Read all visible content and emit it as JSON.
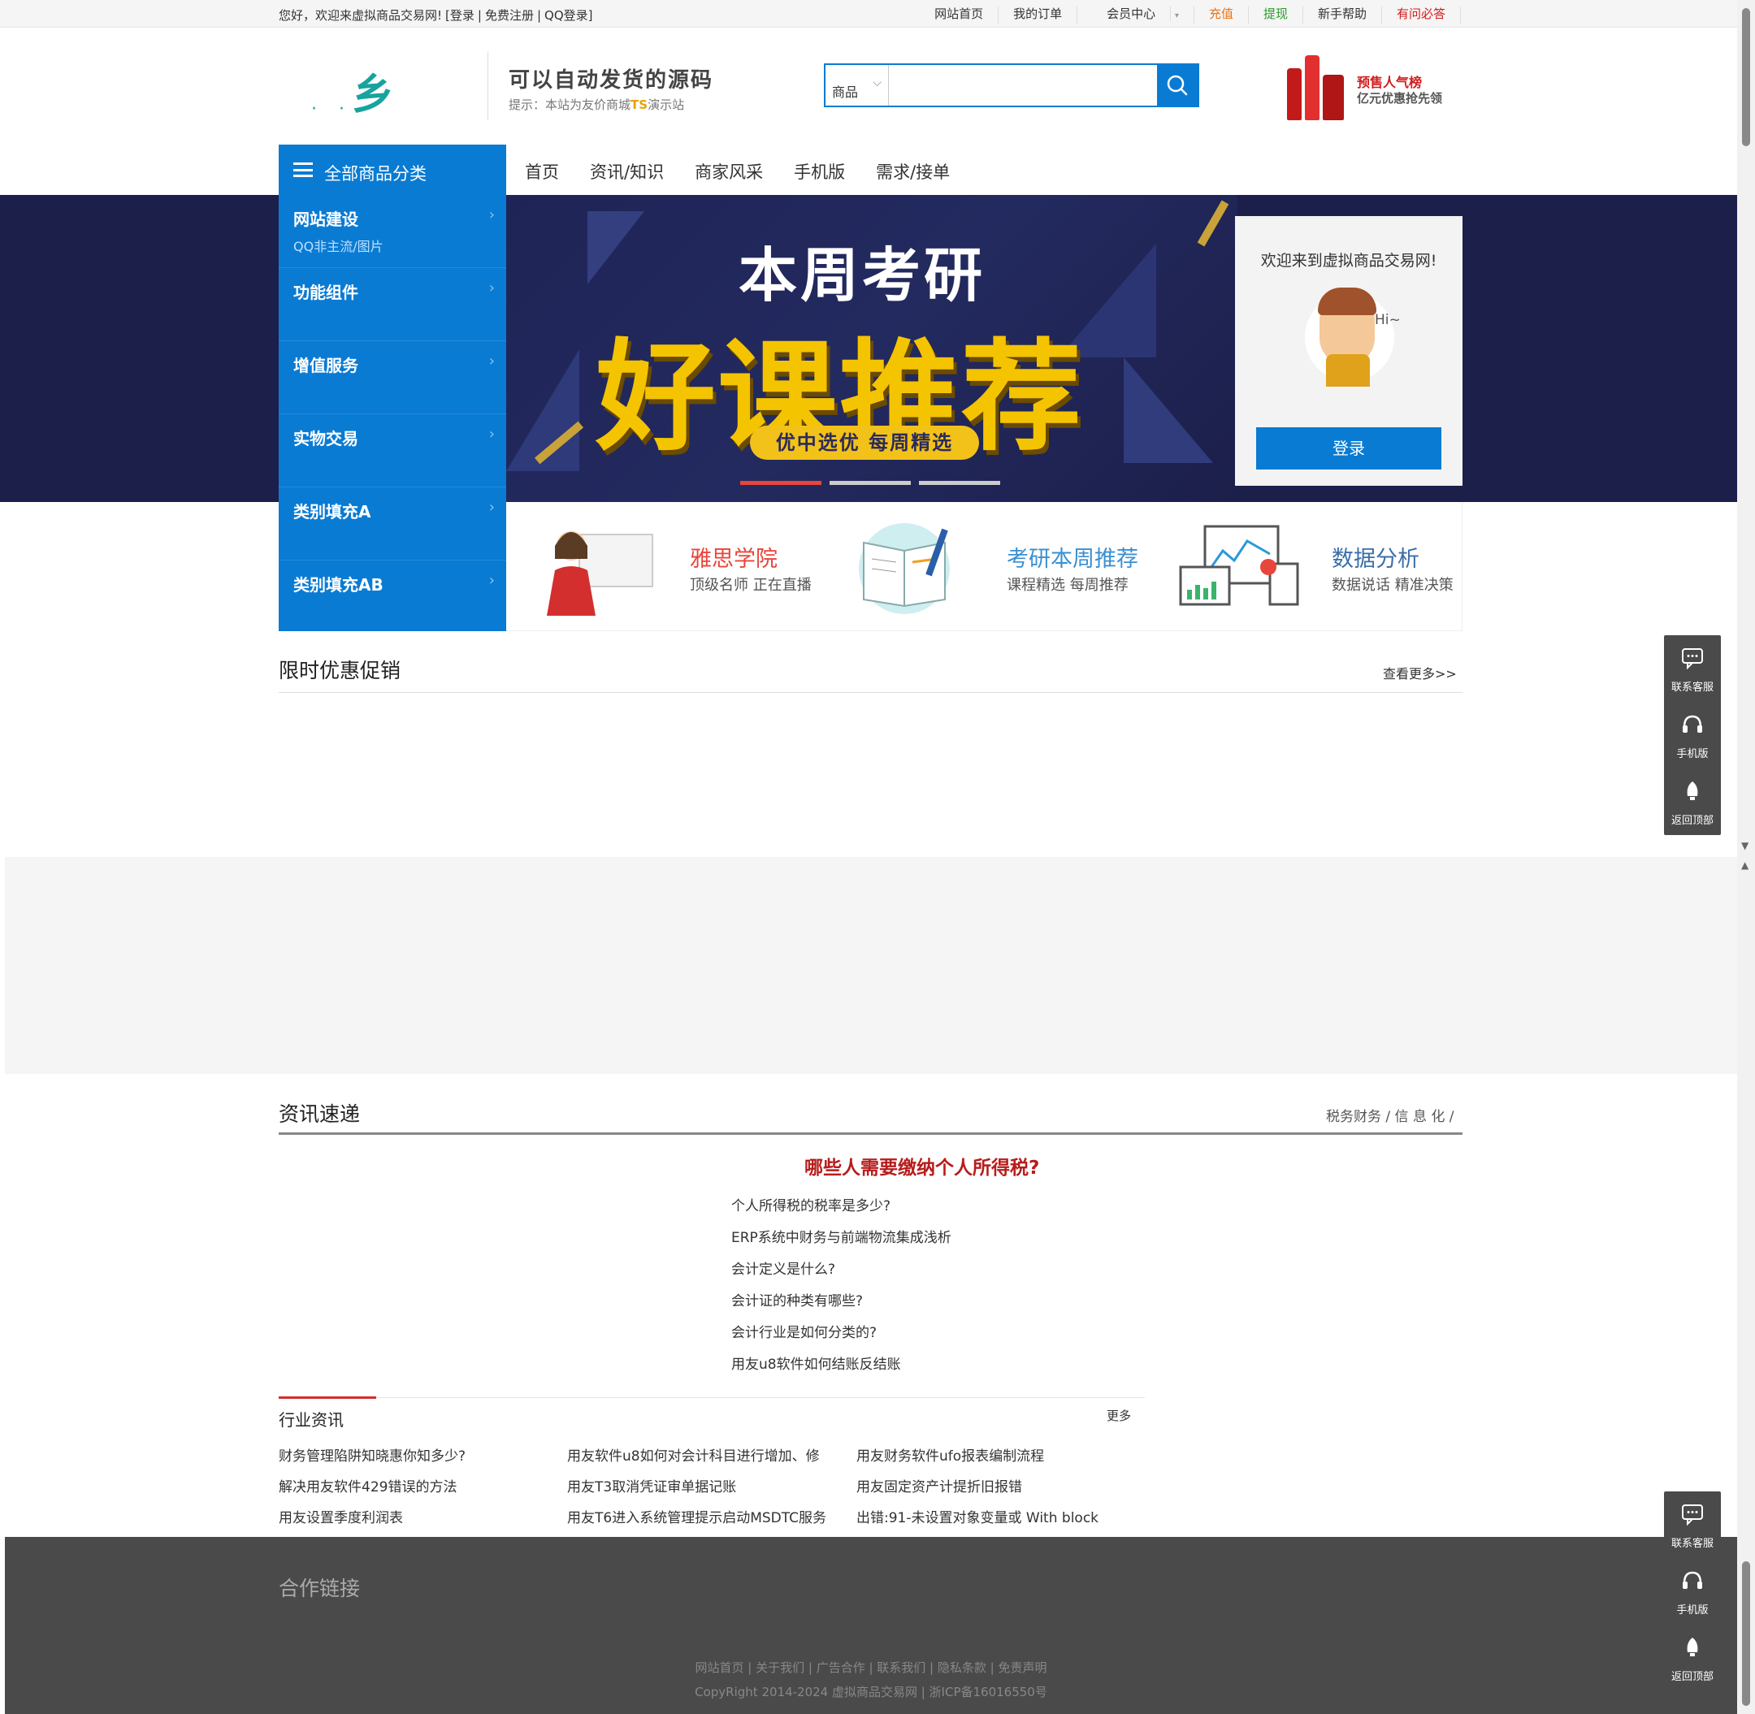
{
  "topbar": {
    "greeting": "您好，欢迎来虚拟商品交易网!",
    "login": "[登录",
    "sep": "|",
    "register": "免费注册",
    "qq_login": "QQ登录]",
    "links": [
      "网站首页",
      "我的订单",
      "会员中心",
      "充值",
      "提现",
      "新手帮助",
      "有问必答"
    ],
    "link_colors": [
      "#333333",
      "#333333",
      "#333333",
      "#e8741a",
      "#2a9a2a",
      "#333333",
      "#d21b1b"
    ]
  },
  "header": {
    "slogan": "可以自动发货的源码",
    "tip_prefix": "提示：本站为友价商城",
    "tip_ts": "TS",
    "tip_suffix": "演示站",
    "search_select": "商品",
    "search_placeholder": "",
    "promo_line1": "预售人气榜",
    "promo_line2": "亿元优惠抢先领"
  },
  "nav": {
    "all_categories": "全部商品分类",
    "items": [
      "首页",
      "资讯/知识",
      "商家风采",
      "手机版",
      "需求/接单"
    ]
  },
  "categories": [
    {
      "name": "网站建设",
      "sub": "QQ非主流/图片"
    },
    {
      "name": "功能组件",
      "sub": ""
    },
    {
      "name": "增值服务",
      "sub": ""
    },
    {
      "name": "实物交易",
      "sub": ""
    },
    {
      "name": "类别填充A",
      "sub": ""
    },
    {
      "name": "类别填充AB",
      "sub": ""
    }
  ],
  "banner": {
    "line1": "本周考研",
    "line2": "好课推荐",
    "pill": "优中选优  每周精选",
    "active_slide": 1,
    "slide_count": 3
  },
  "login_panel": {
    "welcome": "欢迎来到虚拟商品交易网!",
    "hi": "Hi~",
    "button": "登录"
  },
  "features": [
    {
      "title": "雅思学院",
      "desc": "顶级名师 正在直播",
      "color": "#e8453c"
    },
    {
      "title": "考研本周推荐",
      "desc": "课程精选 每周推荐",
      "color": "#3a8fd1"
    },
    {
      "title": "数据分析",
      "desc": "数据说话  精准决策",
      "color": "#3a6fa8"
    }
  ],
  "promo_section": {
    "title": "限时优惠促销",
    "more": "查看更多>>"
  },
  "news_section": {
    "title": "资讯速递",
    "tabs": "税务财务 / 信 息 化 /",
    "headline": "哪些人需要缴纳个人所得税?",
    "items": [
      "个人所得税的税率是多少?",
      "ERP系统中财务与前端物流集成浅析",
      "会计定义是什么?",
      "会计证的种类有哪些?",
      "会计行业是如何分类的?",
      "用友u8软件如何结账反结账"
    ]
  },
  "industry": {
    "title": "行业资讯",
    "more": "更多",
    "col1": [
      "财务管理陷阱知晓惠你知多少?",
      "解决用友软件429错误的方法",
      "用友设置季度利润表"
    ],
    "col2": [
      "用友软件u8如何对会计科目进行增加、修",
      "用友T3取消凭证审单据记账",
      "用友T6进入系统管理提示启动MSDTC服务"
    ],
    "col3": [
      "用友财务软件ufo报表编制流程",
      "用友固定资产计提折旧报错",
      "出错:91-未设置对象变量或 With block"
    ]
  },
  "footer": {
    "coop": "合作链接",
    "links": "网站首页 | 关于我们 | 广告合作 | 联系我们 | 隐私条款 | 免责声明",
    "copyright": "CopyRight 2014-2024 虚拟商品交易网 | 浙ICP备16016550号"
  },
  "sidetools": [
    "联系客服",
    "手机版",
    "返回顶部"
  ]
}
